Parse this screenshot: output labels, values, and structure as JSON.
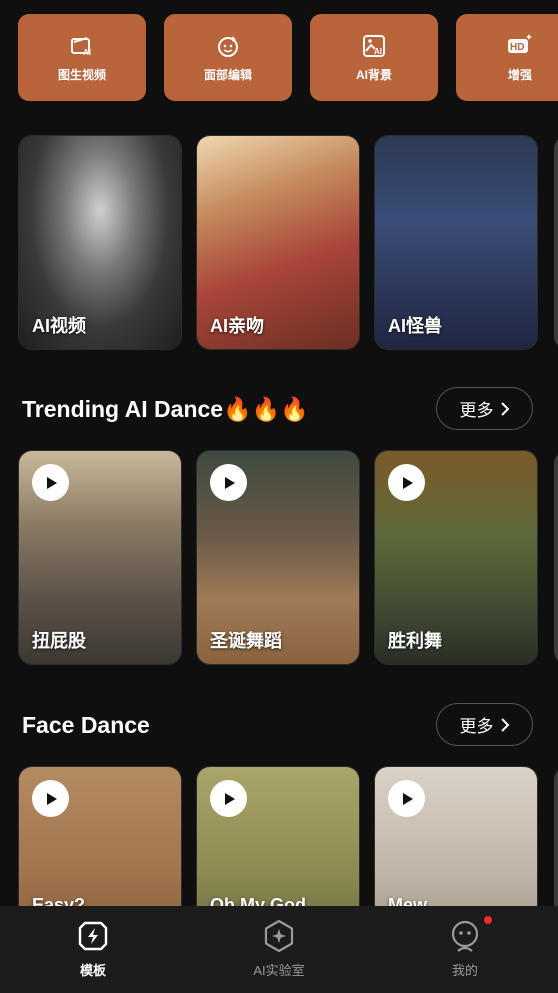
{
  "tools": [
    {
      "label": "图生视频",
      "icon": "image-to-video-icon"
    },
    {
      "label": "面部编辑",
      "icon": "face-edit-icon"
    },
    {
      "label": "AI背景",
      "icon": "ai-background-icon"
    },
    {
      "label": "增强",
      "icon": "hd-enhance-icon"
    }
  ],
  "featured": [
    {
      "caption": "AI视频"
    },
    {
      "caption": "AI亲吻"
    },
    {
      "caption": "AI怪兽"
    }
  ],
  "trending": {
    "title": "Trending AI Dance🔥🔥🔥",
    "more_label": "更多",
    "cards": [
      {
        "caption": "扭屁股"
      },
      {
        "caption": "圣诞舞蹈"
      },
      {
        "caption": "胜利舞"
      }
    ]
  },
  "face_dance": {
    "title": "Face Dance",
    "more_label": "更多",
    "cards": [
      {
        "caption": "Easy?"
      },
      {
        "caption": "Oh My God"
      },
      {
        "caption": "Mew"
      }
    ]
  },
  "nav": [
    {
      "label": "模板",
      "icon": "template-icon",
      "active": true
    },
    {
      "label": "AI实验室",
      "icon": "ai-lab-icon",
      "active": false
    },
    {
      "label": "我的",
      "icon": "profile-icon",
      "active": false
    }
  ],
  "colors": {
    "accent": "#b9643a",
    "background": "#0f0f0f",
    "nav_bg": "#1c1c1c",
    "badge": "#ff2a2a"
  }
}
